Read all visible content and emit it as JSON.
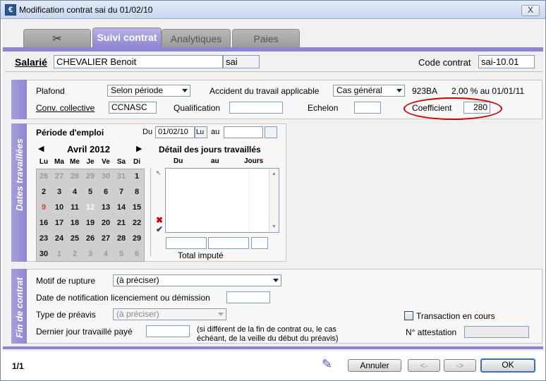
{
  "window": {
    "title": "Modification contrat sai du 01/02/10",
    "close_label": "X"
  },
  "tabs": [
    {
      "label": ""
    },
    {
      "label": "Suivi contrat"
    },
    {
      "label": "Analytiques"
    },
    {
      "label": "Paies"
    }
  ],
  "header": {
    "salarie_label": "Salarié",
    "salarie_name": "CHEVALIER Benoit",
    "salarie_code": "sai",
    "code_contrat_label": "Code contrat",
    "code_contrat_value": "sai-10.01"
  },
  "top": {
    "plafond_label": "Plafond",
    "plafond_value": "Selon période",
    "accident_label": "Accident du travail applicable",
    "accident_value": "Cas général",
    "accident_code": "923BA",
    "accident_rate": "2,00 % au 01/01/11",
    "conv_label": "Conv. collective",
    "conv_value": "CCNASC",
    "qualification_label": "Qualification",
    "qualification_value": "",
    "echelon_label": "Echelon",
    "echelon_value": "",
    "coefficient_label": "Coefficient",
    "coefficient_value": "280"
  },
  "dates": {
    "section_title": "Dates travaillées",
    "periode_label": "Période d'emploi",
    "du_label": "Du",
    "du_value": "01/02/10",
    "du_day": "Lu",
    "au_label": "au",
    "au_value": "",
    "calendar": {
      "prev": "◀",
      "next": "▶",
      "month": "Avril 2012",
      "weekdays": [
        "Lu",
        "Ma",
        "Me",
        "Je",
        "Ve",
        "Sa",
        "Di"
      ],
      "days": [
        [
          "26",
          "27",
          "28",
          "29",
          "30",
          "31",
          "1"
        ],
        [
          "2",
          "3",
          "4",
          "5",
          "6",
          "7",
          "8"
        ],
        [
          "9",
          "10",
          "11",
          "12",
          "13",
          "14",
          "15"
        ],
        [
          "16",
          "17",
          "18",
          "19",
          "20",
          "21",
          "22"
        ],
        [
          "23",
          "24",
          "25",
          "26",
          "27",
          "28",
          "29"
        ],
        [
          "30",
          "1",
          "2",
          "3",
          "4",
          "5",
          "6"
        ]
      ]
    },
    "detail_title": "Détail des jours travaillés",
    "col_du": "Du",
    "col_au": "au",
    "col_jours": "Jours",
    "total_label": "Total imputé"
  },
  "fin": {
    "section_title": "Fin de contrat",
    "motif_label": "Motif de rupture",
    "motif_value": "(à préciser)",
    "notif_label": "Date de notification licenciement ou démission",
    "preavis_label": "Type de préavis",
    "preavis_value": "(à préciser)",
    "dernier_label": "Dernier jour travaillé payé",
    "note_line1": "(si différent de la fin de contrat ou, le cas",
    "note_line2": "échéant, de la veille du début du préavis)",
    "transaction_label": "Transaction en cours",
    "attestation_label": "N° attestation"
  },
  "footer": {
    "page": "1/1",
    "annuler": "Annuler",
    "prev": "<-",
    "next": "->",
    "ok": "OK"
  }
}
